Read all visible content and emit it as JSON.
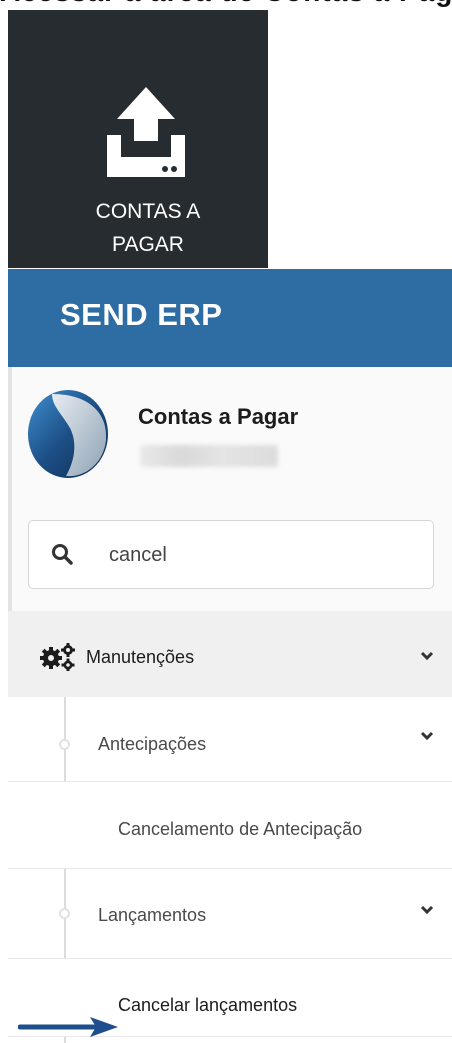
{
  "top_strip": {
    "text": "Acessar a área de Contas a Pagar"
  },
  "tile": {
    "label": "CONTAS A PAGAR",
    "icon": "upload-tray-icon",
    "background": "#262c30"
  },
  "header": {
    "title": "SEND ERP",
    "background": "#2e6da4"
  },
  "profile": {
    "title": "Contas a Pagar",
    "icon": "send-logo-icon"
  },
  "search": {
    "value": "cancel",
    "icon": "search-icon"
  },
  "menu": {
    "group_label": "Manutenções",
    "group_icon": "cogs-icon",
    "items": [
      {
        "label": "Antecipações",
        "expandable": true
      },
      {
        "label": "Cancelamento de Antecipação",
        "expandable": false
      },
      {
        "label": "Lançamentos",
        "expandable": true
      },
      {
        "label": "Cancelar lançamentos",
        "expandable": false,
        "highlighted": true
      }
    ]
  },
  "annotation": {
    "icon": "pointer-arrow-icon",
    "color": "#1f4e8c"
  }
}
